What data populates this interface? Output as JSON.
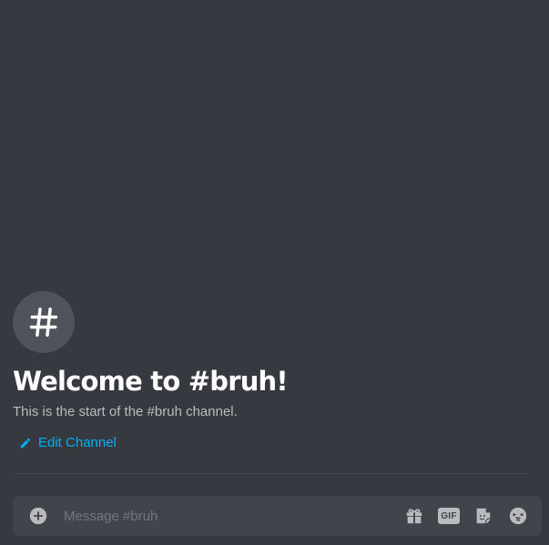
{
  "channel": {
    "name": "bruh",
    "welcome_title": "Welcome to #bruh!",
    "welcome_subtitle": "This is the start of the #bruh channel.",
    "edit_label": "Edit Channel"
  },
  "composer": {
    "placeholder": "Message #bruh",
    "gif_label": "GIF"
  },
  "icons": {
    "channel": "hash-icon",
    "edit": "pencil-icon",
    "attach": "plus-circle-icon",
    "gift": "gift-icon",
    "gif": "gif-icon",
    "sticker": "sticker-icon",
    "emoji": "emoji-icon"
  },
  "colors": {
    "background": "#36393f",
    "composer_background": "#40444b",
    "link": "#00b0f4",
    "title": "#ffffff",
    "subtitle": "#b9bbbe",
    "icon_circle": "#4f545c",
    "placeholder": "#72767d"
  }
}
